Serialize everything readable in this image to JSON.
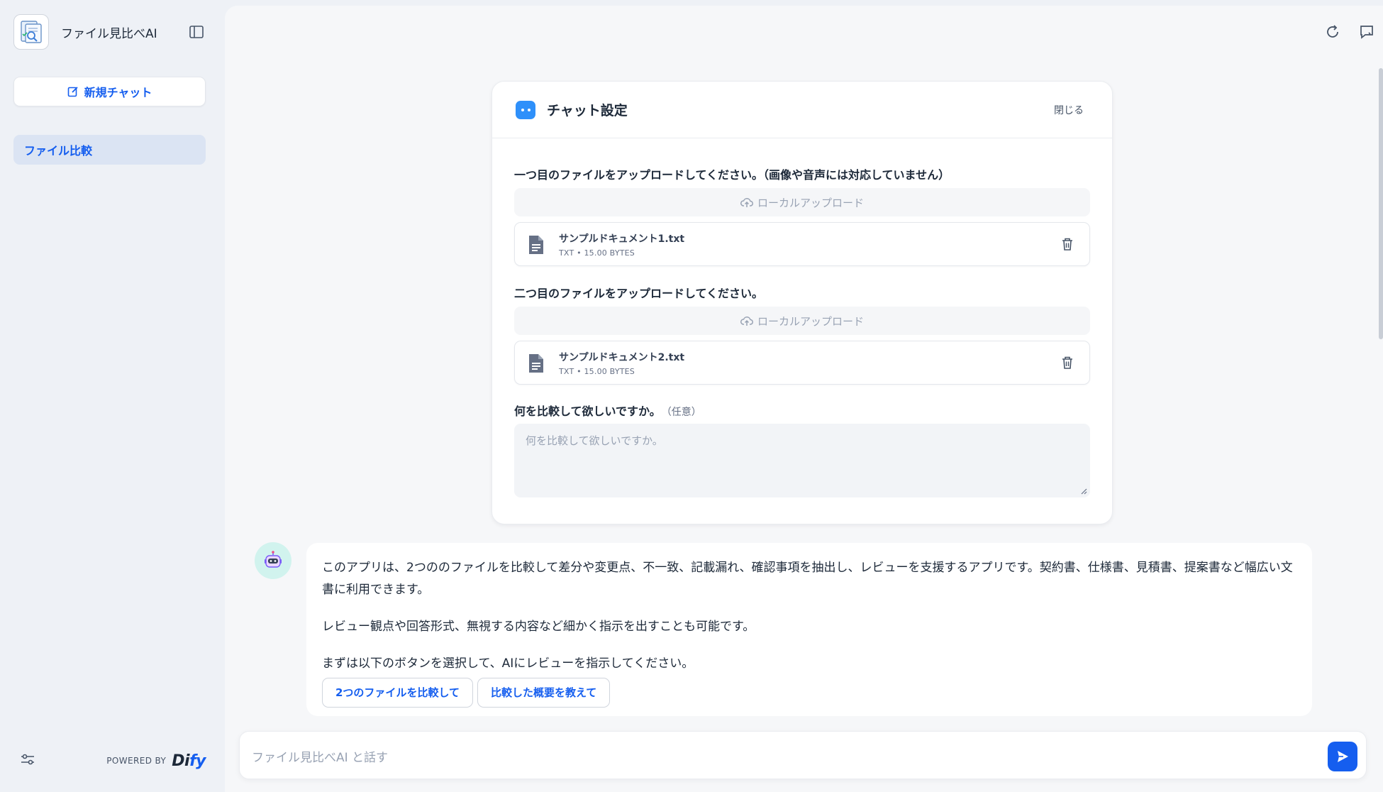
{
  "app": {
    "name": "ファイル見比べAI"
  },
  "sidebar": {
    "new_chat_label": "新規チャット",
    "conversations": [
      {
        "label": "ファイル比較",
        "active": true
      }
    ],
    "powered_by": "POWERED BY",
    "brand_prefix": "Di",
    "brand_suffix": "fy"
  },
  "settings": {
    "title": "チャット設定",
    "close_label": "閉じる",
    "file1": {
      "label": "一つ目のファイルをアップロードしてください。（画像や音声には対応していません）",
      "upload_label": "ローカルアップロード",
      "name": "サンプルドキュメント1.txt",
      "type": "TXT",
      "size": "15.00 BYTES"
    },
    "file2": {
      "label": "二つ目のファイルをアップロードしてください。",
      "upload_label": "ローカルアップロード",
      "name": "サンプルドキュメント2.txt",
      "type": "TXT",
      "size": "15.00 BYTES"
    },
    "question": {
      "label": "何を比較して欲しいですか。",
      "optional": "（任意）",
      "placeholder": "何を比較して欲しいですか。"
    }
  },
  "message": {
    "paragraphs": [
      "このアプリは、2つののファイルを比較して差分や変更点、不一致、記載漏れ、確認事項を抽出し、レビューを支援するアプリです。契約書、仕様書、見積書、提案書など幅広い文書に利用できます。",
      "レビュー観点や回答形式、無視する内容など細かく指示を出すことも可能です。",
      "まずは以下のボタンを選択して、AIにレビューを指示してください。"
    ],
    "suggestions": [
      "2つのファイルを比較して",
      "比較した概要を教えて"
    ]
  },
  "input": {
    "placeholder": "ファイル見比べAI と話す"
  },
  "colors": {
    "accent": "#155eef",
    "sidebar_bg": "#eef1f6",
    "active_item_bg": "#dbe4f3"
  }
}
